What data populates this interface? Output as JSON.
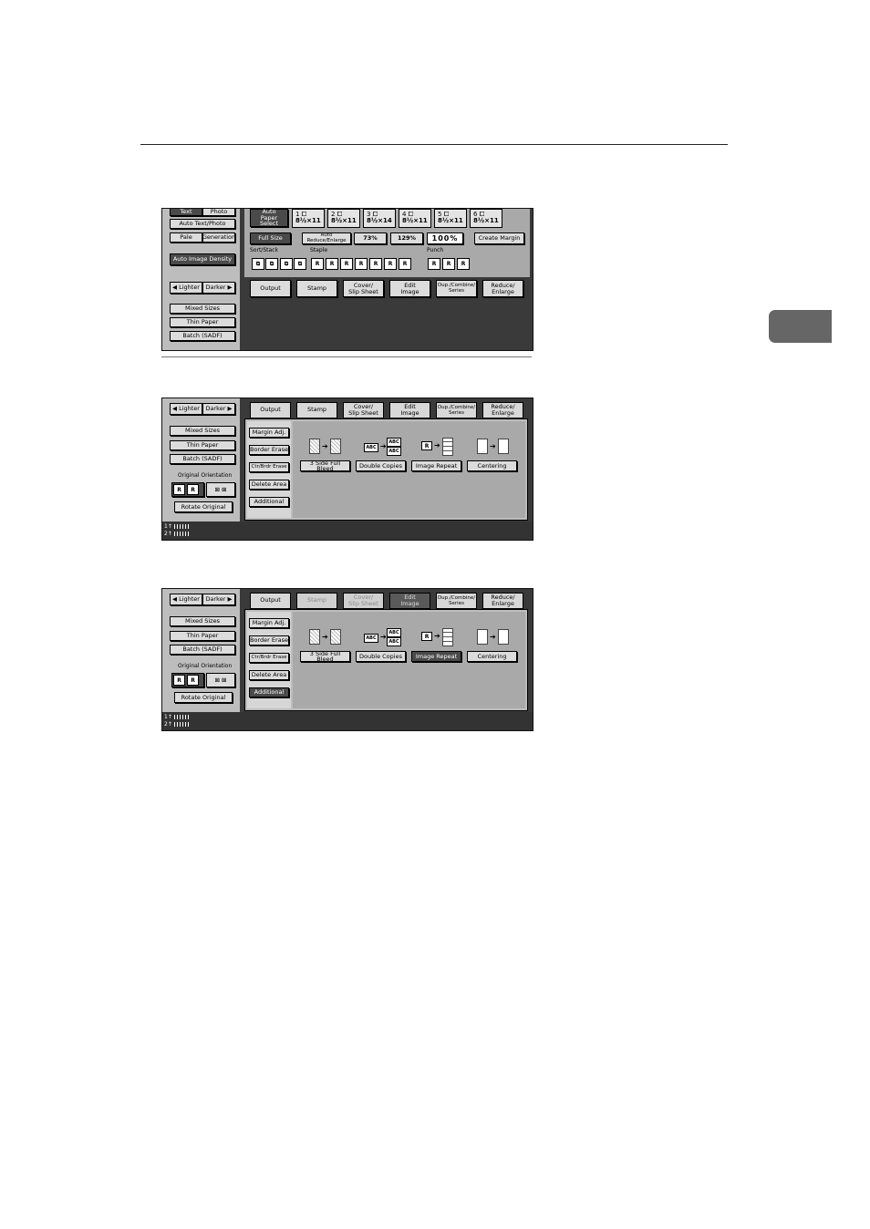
{
  "screen1": {
    "left": {
      "text_tab": "Text",
      "photo_tab": "Photo",
      "auto_text_photo": "Auto Text/Photo",
      "pale": "Pale",
      "generation": "Generation",
      "auto_image_density": "Auto Image Density",
      "lighter": "Lighter",
      "darker": "Darker",
      "mixed_sizes": "Mixed Sizes",
      "thin_paper": "Thin Paper",
      "batch": "Batch (SADF)"
    },
    "paper": {
      "auto": "Auto\nPaper Select",
      "trays": [
        {
          "num": "1",
          "size": "8½×11"
        },
        {
          "num": "2",
          "size": "8½×11"
        },
        {
          "num": "3",
          "size": "8½×14"
        },
        {
          "num": "4",
          "size": "8½×11"
        },
        {
          "num": "5",
          "size": "8½×11"
        },
        {
          "num": "6",
          "size": "8½×11"
        }
      ]
    },
    "ratio": {
      "full_size": "Full Size",
      "auto_reduce_enlarge": "Auto Reduce/Enlarge",
      "r73": "73%",
      "r129": "129%",
      "current": "100%",
      "create_margin": "Create Margin"
    },
    "finishing": {
      "sort_stack": "Sort/Stack",
      "staple": "Staple",
      "punch": "Punch"
    },
    "tabs": {
      "output": "Output",
      "stamp": "Stamp",
      "cover": "Cover/\nSlip Sheet",
      "edit": "Edit\nImage",
      "dup": "Dup./Combine/\nSeries",
      "reduce": "Reduce/\nEnlarge"
    }
  },
  "screen2": {
    "left": {
      "lighter": "Lighter",
      "darker": "Darker",
      "mixed_sizes": "Mixed Sizes",
      "thin_paper": "Thin Paper",
      "batch": "Batch (SADF)",
      "orientation_label": "Original Orientation",
      "rotate_original": "Rotate Original"
    },
    "tabs": {
      "output": "Output",
      "stamp": "Stamp",
      "cover": "Cover/\nSlip Sheet",
      "edit": "Edit\nImage",
      "dup": "Dup./Combine/\nSeries",
      "reduce": "Reduce/\nEnlarge"
    },
    "edit": {
      "margin_adj": "Margin Adj.",
      "border_erase": "Border Erase",
      "center_erase": "Ctr/Brdr Erase",
      "delete_area": "Delete Area",
      "additional": "Additional",
      "three_side": "3 Side Full Bleed",
      "double_copies": "Double Copies",
      "image_repeat": "Image Repeat",
      "centering": "Centering"
    },
    "status": {
      "line1": "1↑",
      "line2": "2↑"
    }
  },
  "screen3": {
    "left": {
      "lighter": "Lighter",
      "darker": "Darker",
      "mixed_sizes": "Mixed Sizes",
      "thin_paper": "Thin Paper",
      "batch": "Batch (SADF)",
      "orientation_label": "Original Orientation",
      "rotate_original": "Rotate Original"
    },
    "tabs": {
      "output": "Output",
      "stamp": "Stamp",
      "cover": "Cover/\nSlip Sheet",
      "edit": "Edit\nImage",
      "dup": "Dup./Combine/\nSeries",
      "reduce": "Reduce/\nEnlarge"
    },
    "edit": {
      "margin_adj": "Margin Adj.",
      "border_erase": "Border Erase",
      "center_erase": "Ctr/Brdr Erase",
      "delete_area": "Delete Area",
      "additional": "Additional",
      "three_side": "3 Side Full Bleed",
      "double_copies": "Double Copies",
      "image_repeat": "Image Repeat",
      "centering": "Centering"
    },
    "status": {
      "line1": "1↑",
      "line2": "2↑"
    }
  },
  "icons": {
    "r_glyph": "R",
    "abc_glyph": "ABC",
    "arrow_glyph": "➔"
  },
  "colors": {
    "panel": "#bdbdbd",
    "dark": "#3a3a3a",
    "active_tab": "#5a5a5a",
    "side_tab": "#666666"
  }
}
